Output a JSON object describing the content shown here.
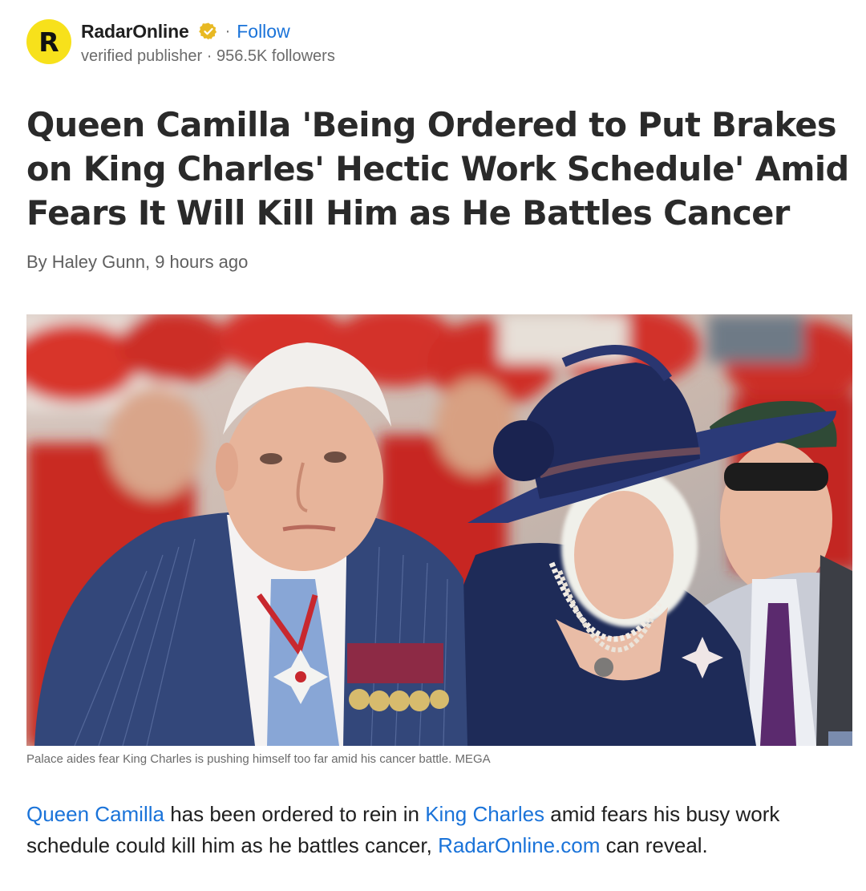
{
  "publisher": {
    "logo_letter": "R",
    "name": "RadarOnline",
    "verified_icon": "verified-badge-icon",
    "separator": "·",
    "follow_label": "Follow",
    "subtitle": "verified publisher · 956.5K followers"
  },
  "article": {
    "headline": "Queen Camilla 'Being Ordered to Put Brakes on King Charles' Hectic Work Schedule' Amid Fears It Will Kill Him as He Battles Cancer",
    "byline": "By Haley Gunn, 9 hours ago",
    "image_caption": "Palace aides fear King Charles is pushing himself too far amid his cancer battle. MEGA",
    "body": {
      "link1": "Queen Camilla",
      "text1": " has been ordered to rein in ",
      "link2": "King Charles",
      "text2": " amid fears his busy work schedule could kill him as he battles cancer, ",
      "link3": "RadarOnline.com",
      "text3": " can reveal."
    }
  },
  "colors": {
    "logo_bg": "#f7e11b",
    "link": "#1a73d9",
    "badge": "#e8b923"
  }
}
